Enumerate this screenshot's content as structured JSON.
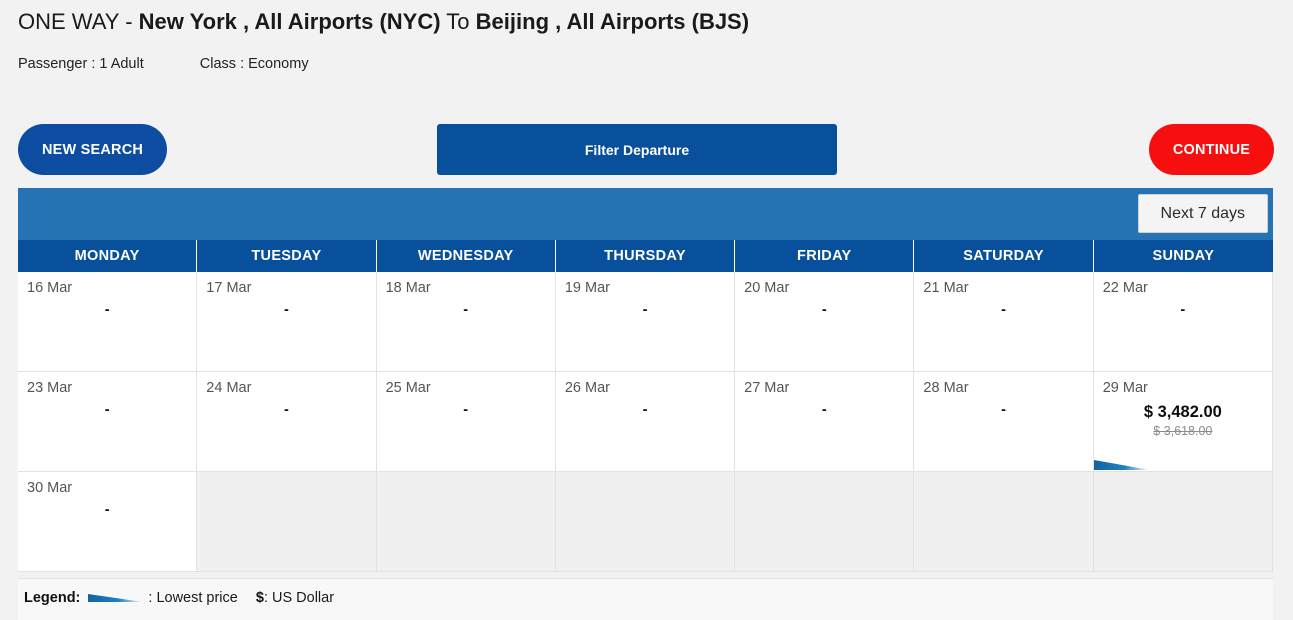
{
  "header": {
    "trip_type": "ONE WAY",
    "separator": "-",
    "origin": "New York , All Airports (NYC)",
    "to_word": "To",
    "destination": "Beijing , All Airports (BJS)",
    "passenger": "Passenger : 1 Adult",
    "class": "Class : Economy"
  },
  "actions": {
    "new_search": "NEW SEARCH",
    "filter_departure": "Filter Departure",
    "continue": "CONTINUE"
  },
  "calendar": {
    "next_days_button": "Next 7 days",
    "weekdays": [
      "MONDAY",
      "TUESDAY",
      "WEDNESDAY",
      "THURSDAY",
      "FRIDAY",
      "SATURDAY",
      "SUNDAY"
    ],
    "no_fare_symbol": "-",
    "cells": [
      {
        "date": "16 Mar",
        "fare": "-",
        "old_fare": "",
        "lowest": false,
        "empty": false
      },
      {
        "date": "17 Mar",
        "fare": "-",
        "old_fare": "",
        "lowest": false,
        "empty": false
      },
      {
        "date": "18 Mar",
        "fare": "-",
        "old_fare": "",
        "lowest": false,
        "empty": false
      },
      {
        "date": "19 Mar",
        "fare": "-",
        "old_fare": "",
        "lowest": false,
        "empty": false
      },
      {
        "date": "20 Mar",
        "fare": "-",
        "old_fare": "",
        "lowest": false,
        "empty": false
      },
      {
        "date": "21 Mar",
        "fare": "-",
        "old_fare": "",
        "lowest": false,
        "empty": false
      },
      {
        "date": "22 Mar",
        "fare": "-",
        "old_fare": "",
        "lowest": false,
        "empty": false
      },
      {
        "date": "23 Mar",
        "fare": "-",
        "old_fare": "",
        "lowest": false,
        "empty": false
      },
      {
        "date": "24 Mar",
        "fare": "-",
        "old_fare": "",
        "lowest": false,
        "empty": false
      },
      {
        "date": "25 Mar",
        "fare": "-",
        "old_fare": "",
        "lowest": false,
        "empty": false
      },
      {
        "date": "26 Mar",
        "fare": "-",
        "old_fare": "",
        "lowest": false,
        "empty": false
      },
      {
        "date": "27 Mar",
        "fare": "-",
        "old_fare": "",
        "lowest": false,
        "empty": false
      },
      {
        "date": "28 Mar",
        "fare": "-",
        "old_fare": "",
        "lowest": false,
        "empty": false
      },
      {
        "date": "29 Mar",
        "fare": "$ 3,482.00",
        "old_fare": "$ 3,618.00",
        "lowest": true,
        "empty": false
      },
      {
        "date": "30 Mar",
        "fare": "-",
        "old_fare": "",
        "lowest": false,
        "empty": false
      },
      {
        "date": "",
        "fare": "",
        "old_fare": "",
        "lowest": false,
        "empty": true
      },
      {
        "date": "",
        "fare": "",
        "old_fare": "",
        "lowest": false,
        "empty": true
      },
      {
        "date": "",
        "fare": "",
        "old_fare": "",
        "lowest": false,
        "empty": true
      },
      {
        "date": "",
        "fare": "",
        "old_fare": "",
        "lowest": false,
        "empty": true
      },
      {
        "date": "",
        "fare": "",
        "old_fare": "",
        "lowest": false,
        "empty": true
      },
      {
        "date": "",
        "fare": "",
        "old_fare": "",
        "lowest": false,
        "empty": true
      }
    ]
  },
  "legend": {
    "title": "Legend:",
    "lowest_price_text": ": Lowest price",
    "currency_symbol": "$",
    "currency_text": ": US Dollar"
  },
  "colors": {
    "page_background": "#f2f2f2",
    "primary_blue": "#084f9c",
    "toolbar_blue": "#2573b5",
    "header_blue": "#08509c",
    "pill_blue": "#0c4da2",
    "continue_red": "#f70f0f",
    "marker_blue": "#1b72b0",
    "cell_empty": "#f0f0f0"
  }
}
